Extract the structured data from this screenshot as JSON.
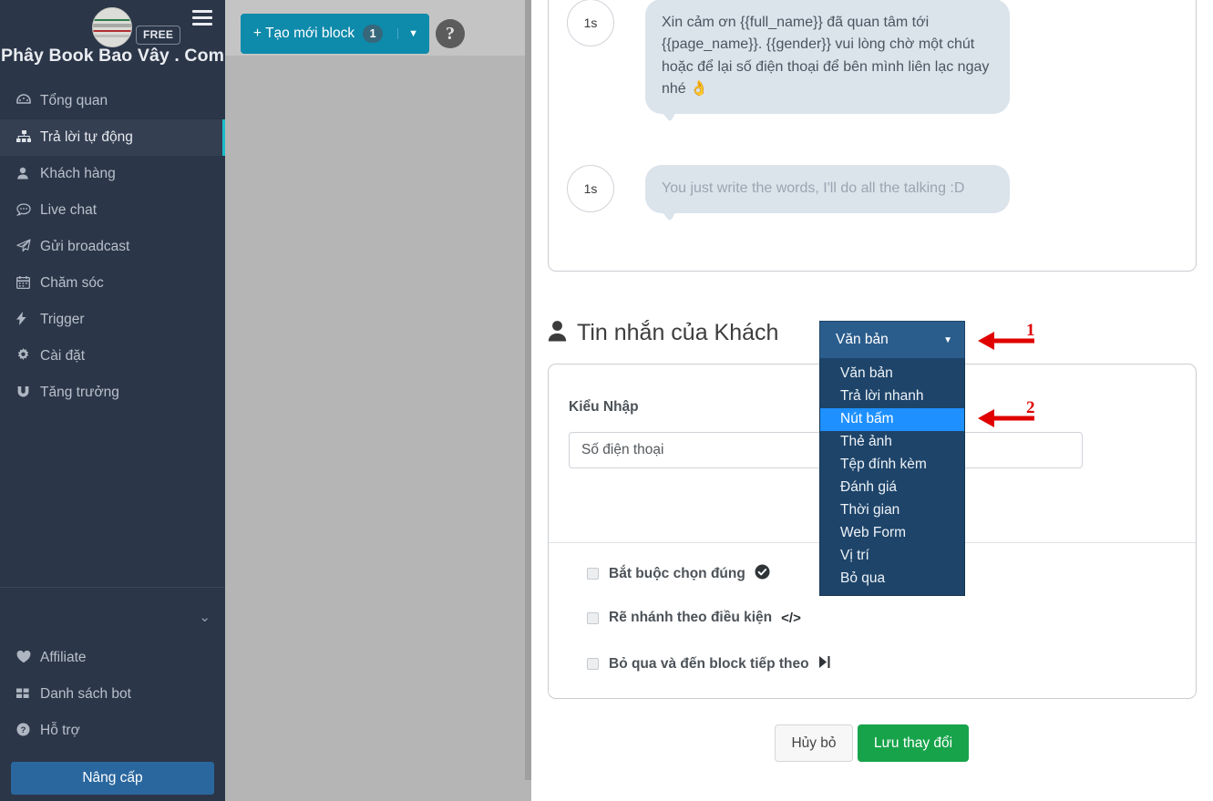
{
  "sidebar": {
    "badge": "FREE",
    "brand": "Phây Book Bao Vây . Com",
    "items": [
      {
        "label": "Tổng quan",
        "icon": "dashboard-icon",
        "glyph": "◉"
      },
      {
        "label": "Trả lời tự động",
        "icon": "sitemap-icon",
        "glyph": "⌗"
      },
      {
        "label": "Khách hàng",
        "icon": "user-icon",
        "glyph": "👤"
      },
      {
        "label": "Live chat",
        "icon": "comment-icon",
        "glyph": "💬"
      },
      {
        "label": "Gửi broadcast",
        "icon": "paper-plane-icon",
        "glyph": "➤"
      },
      {
        "label": "Chăm sóc",
        "icon": "calendar-icon",
        "glyph": "▦"
      },
      {
        "label": "Trigger",
        "icon": "bolt-icon",
        "glyph": "⚡"
      },
      {
        "label": "Cài đặt",
        "icon": "gear-icon",
        "glyph": "✿"
      },
      {
        "label": "Tăng trưởng",
        "icon": "magnet-icon",
        "glyph": "∪"
      }
    ],
    "active_index": 1,
    "bottom_items": [
      {
        "label": "Affiliate",
        "icon": "heart-icon",
        "glyph": "♥"
      },
      {
        "label": "Danh sách bot",
        "icon": "grid-icon",
        "glyph": "▦"
      },
      {
        "label": "Hỗ trợ",
        "icon": "question-circle-icon",
        "glyph": "?"
      }
    ],
    "upgrade_label": "Nâng cấp",
    "accent_color": "#19bfc9",
    "background_color": "#2b3648"
  },
  "toolbar": {
    "create_block_label": "+ Tạo mới block",
    "block_count": "1",
    "help_label": "?",
    "button_color": "#0e8aab"
  },
  "chat": {
    "messages": [
      {
        "delay": "1s",
        "text": "Xin cảm ơn {{full_name}} đã quan tâm tới {{page_name}}. {{gender}} vui lòng chờ một chút hoặc để lại số điện thoại để bên mình liên lạc ngay nhé 👌",
        "faded": false
      },
      {
        "delay": "1s",
        "text": "You just write the words, I'll do all the talking :D",
        "faded": true
      }
    ]
  },
  "section": {
    "title": "Tin nhắn của Khách"
  },
  "dropdown": {
    "selected": "Văn bản",
    "highlighted": "Nút bấm",
    "options": [
      "Văn bản",
      "Trả lời nhanh",
      "Nút bấm",
      "Thẻ ảnh",
      "Tệp đính kèm",
      "Đánh giá",
      "Thời gian",
      "Web Form",
      "Vị trí",
      "Bỏ qua"
    ],
    "button_color": "#2b5d8c",
    "list_color": "#1e4469",
    "highlight_color": "#1e90ff"
  },
  "annotations": [
    {
      "number": "1",
      "color": "#e00000"
    },
    {
      "number": "2",
      "color": "#e00000"
    }
  ],
  "form": {
    "field_label": "Kiểu Nhập",
    "input_value": "Số điện thoại",
    "input_placeholder": "Số điện thoại",
    "checks": [
      {
        "label": "Bắt buộc chọn đúng",
        "icon": "check-circle-icon",
        "glyph": "✔",
        "checked": false
      },
      {
        "label": "Rẽ nhánh theo điều kiện",
        "icon": "code-icon",
        "glyph": "</>",
        "checked": false
      },
      {
        "label": "Bỏ qua và đến block tiếp theo",
        "icon": "step-forward-icon",
        "glyph": "▶|",
        "checked": false
      }
    ]
  },
  "footer": {
    "cancel_label": "Hủy bỏ",
    "save_label": "Lưu thay đổi",
    "save_color": "#17a34a"
  }
}
